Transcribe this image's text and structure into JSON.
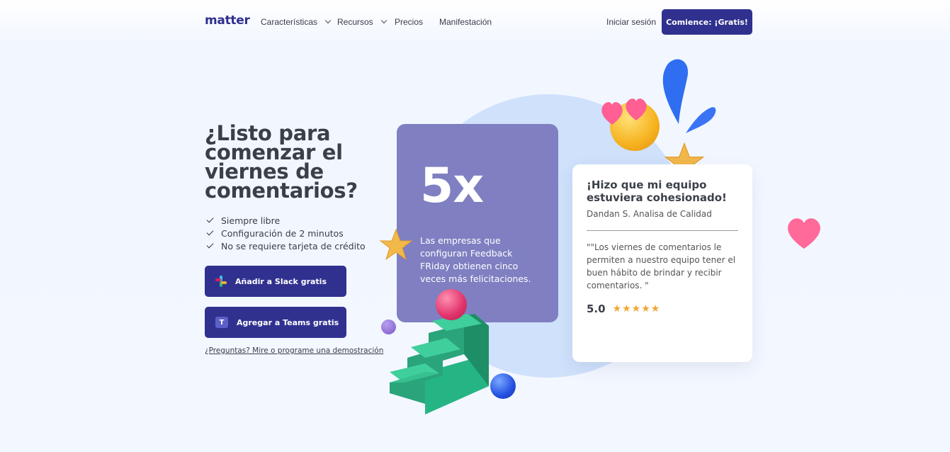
{
  "nav": {
    "logo": "matter",
    "links": [
      "Características",
      "Recursos",
      "Precios",
      "Manifestación"
    ],
    "login": "Iniciar sesión",
    "cta": "Comience: ¡Gratis!"
  },
  "hero": {
    "headline": "¿Listo para comenzar el viernes de comentarios?",
    "checks": [
      "Siempre libre",
      "Configuración de 2 minutos",
      "No se requiere tarjeta de crédito"
    ],
    "slack_button": "Añadir a Slack gratis",
    "teams_button": "Agregar a Teams gratis",
    "demo_link": "¿Preguntas? Mire o programe una demostración"
  },
  "stat": {
    "value": "5x",
    "text": "Las empresas que configuran Feedback FRiday obtienen cinco veces más felicitaciones."
  },
  "review": {
    "title": "¡Hizo que mi equipo estuviera cohesionado!",
    "author": "Dandan S. Analisa de Calidad",
    "quote": "\"\"Los viernes de comentarios le permiten a nuestro equipo tener el buen hábito de brindar y recibir comentarios. \"",
    "score": "5.0",
    "stars": "★★★★★"
  },
  "colors": {
    "brand": "#30318f",
    "stat_card": "#7f7fc2",
    "star": "#f0a733",
    "accent_circle": "#cfe1fb"
  },
  "icons": [
    "chevron-down-icon",
    "check-icon",
    "slack-icon",
    "teams-icon",
    "star-icon",
    "heart-icon",
    "emoji-icon"
  ]
}
